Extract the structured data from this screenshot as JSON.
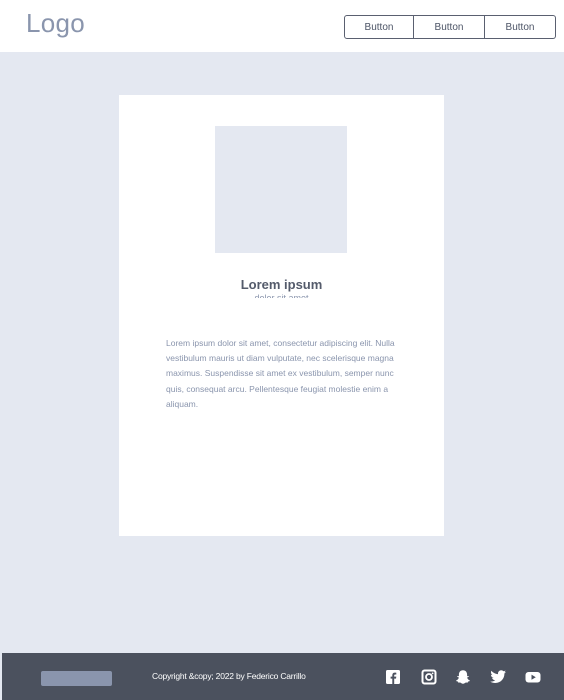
{
  "header": {
    "logo": "Logo",
    "buttons": [
      "Button",
      "Button",
      "Button"
    ]
  },
  "card": {
    "title": "Lorem ipsum",
    "subtitle": "dolor sit amet",
    "body": "Lorem ipsum dolor sit amet, consectetur adipiscing elit. Nulla vestibulum mauris ut diam vulputate, nec scelerisque magna maximus. Suspendisse sit amet ex vestibulum, semper nunc quis, consequat arcu. Pellentesque feugiat molestie enim a aliquam."
  },
  "footer": {
    "copyright": "Copyright &copy; 2022 by Federico Carrillo",
    "social_icons": [
      "facebook-icon",
      "instagram-icon",
      "snapchat-icon",
      "twitter-icon",
      "youtube-icon"
    ]
  },
  "colors": {
    "page_background": "#e4e8f1",
    "footer_background": "#4b515e",
    "logo_text": "#8a95ad",
    "title_text": "#545b6b"
  }
}
